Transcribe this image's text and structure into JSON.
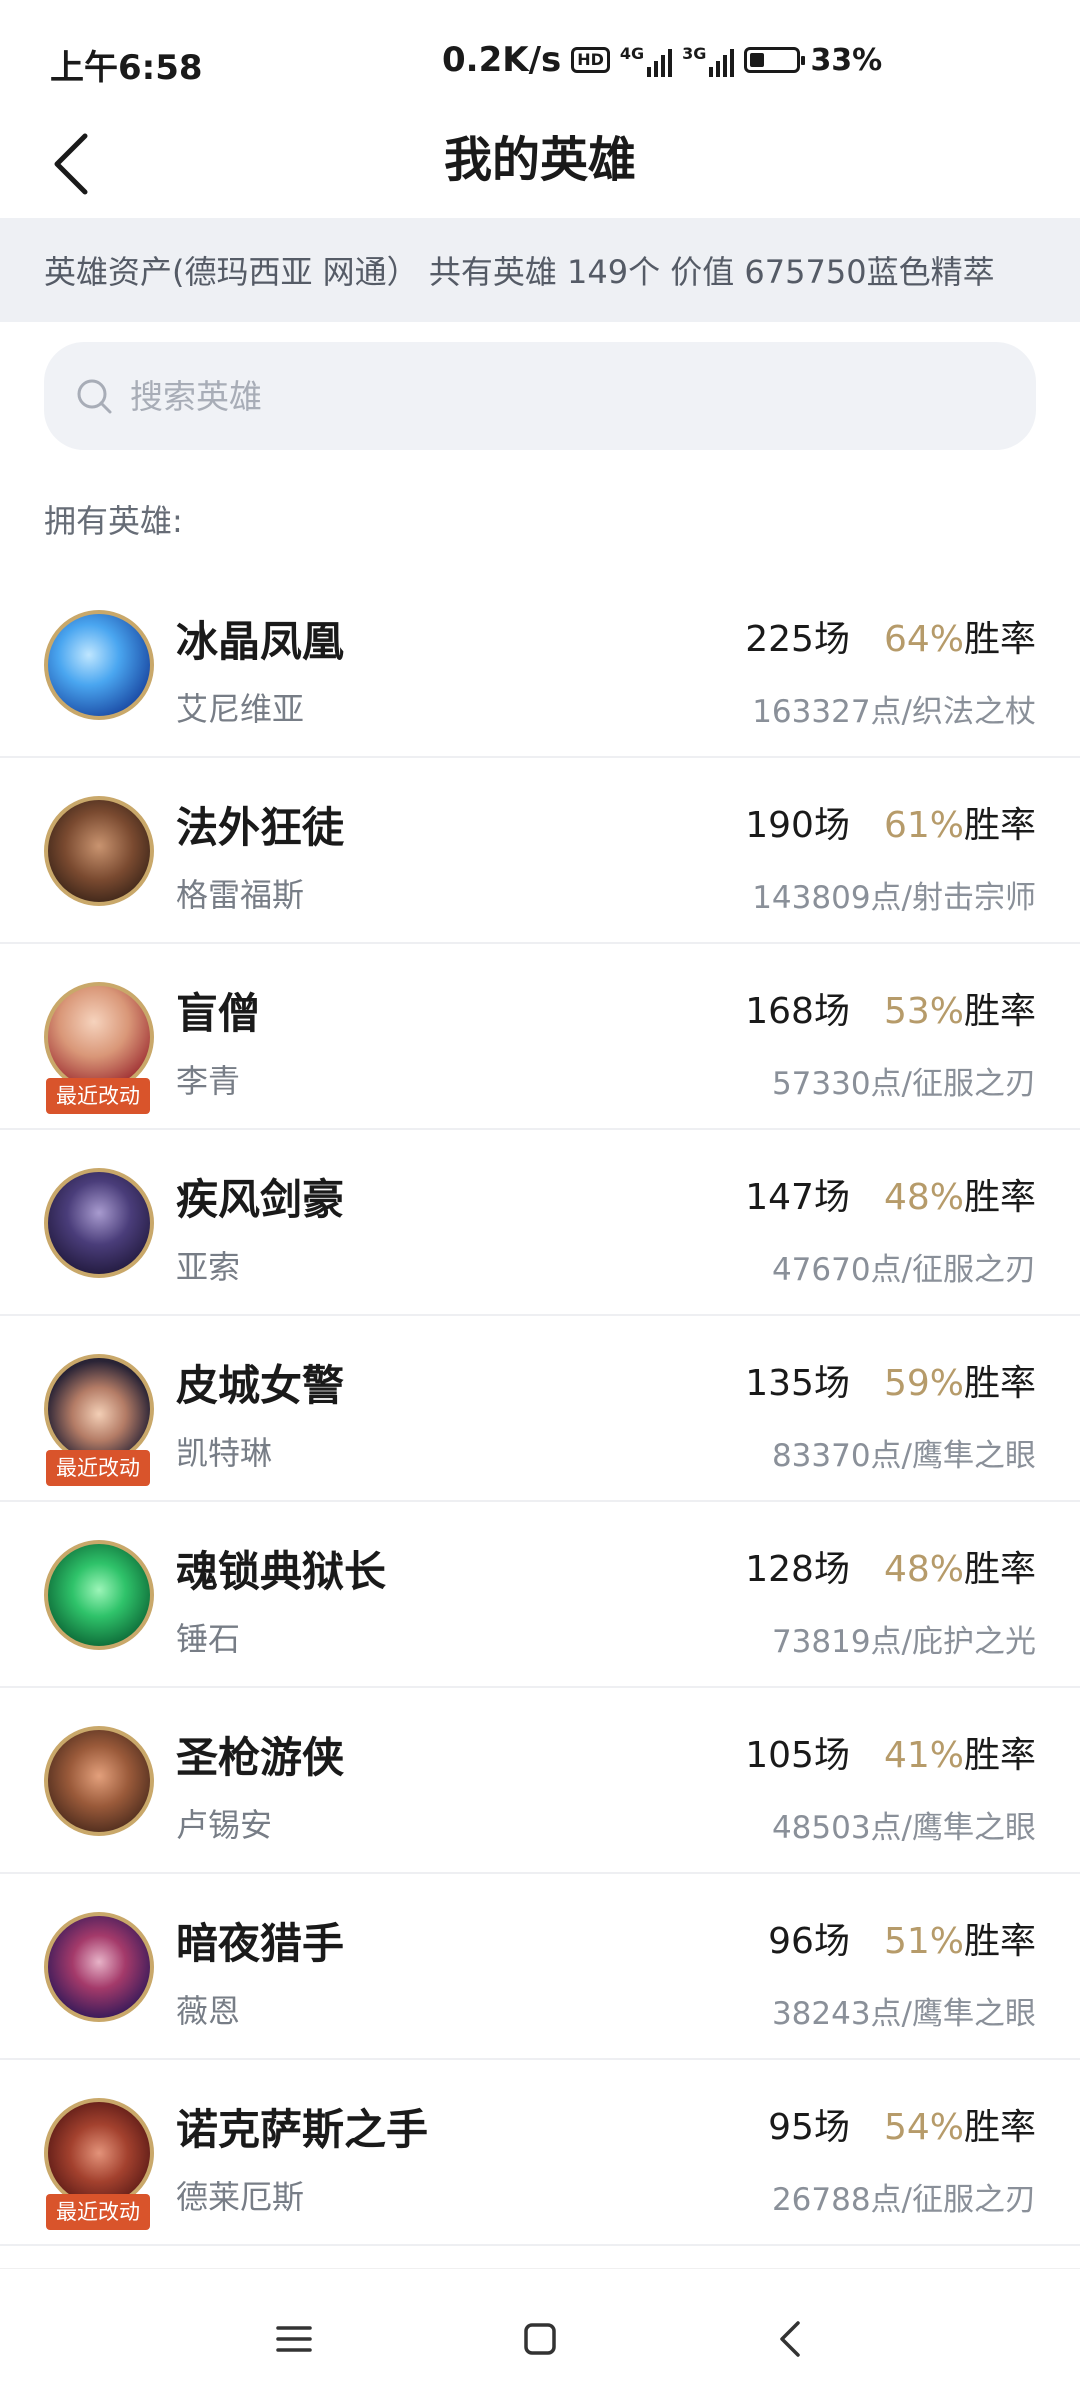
{
  "status_bar": {
    "time": "上午6:58",
    "speed": "0.2K/s",
    "hd": "HD",
    "net1": "4G",
    "net2": "3G",
    "battery": "33%"
  },
  "header": {
    "title": "我的英雄",
    "back_icon": "chevron-left-icon"
  },
  "banner": {
    "text": "英雄资产(德玛西亚 网通） 共有英雄 149个  价值 675750蓝色精萃"
  },
  "search": {
    "placeholder": "搜索英雄",
    "value": ""
  },
  "owned_label": "拥有英雄:",
  "colors": {
    "win_pct": "#b69b6a",
    "badge": "#d9542b",
    "avatar_border": "#c9a86a"
  },
  "heroes": [
    {
      "title": "冰晶凤凰",
      "name": "艾尼维亚",
      "games": "225场",
      "win_pct": "64%",
      "win_label": "胜率",
      "points": "163327点/织法之杖",
      "badge": ""
    },
    {
      "title": "法外狂徒",
      "name": "格雷福斯",
      "games": "190场",
      "win_pct": "61%",
      "win_label": "胜率",
      "points": "143809点/射击宗师",
      "badge": ""
    },
    {
      "title": "盲僧",
      "name": "李青",
      "games": "168场",
      "win_pct": "53%",
      "win_label": "胜率",
      "points": "57330点/征服之刃",
      "badge": "最近改动"
    },
    {
      "title": "疾风剑豪",
      "name": "亚索",
      "games": "147场",
      "win_pct": "48%",
      "win_label": "胜率",
      "points": "47670点/征服之刃",
      "badge": ""
    },
    {
      "title": "皮城女警",
      "name": "凯特琳",
      "games": "135场",
      "win_pct": "59%",
      "win_label": "胜率",
      "points": "83370点/鹰隼之眼",
      "badge": "最近改动"
    },
    {
      "title": "魂锁典狱长",
      "name": "锤石",
      "games": "128场",
      "win_pct": "48%",
      "win_label": "胜率",
      "points": "73819点/庇护之光",
      "badge": ""
    },
    {
      "title": "圣枪游侠",
      "name": "卢锡安",
      "games": "105场",
      "win_pct": "41%",
      "win_label": "胜率",
      "points": "48503点/鹰隼之眼",
      "badge": ""
    },
    {
      "title": "暗夜猎手",
      "name": "薇恩",
      "games": "96场",
      "win_pct": "51%",
      "win_label": "胜率",
      "points": "38243点/鹰隼之眼",
      "badge": ""
    },
    {
      "title": "诺克萨斯之手",
      "name": "德莱厄斯",
      "games": "95场",
      "win_pct": "54%",
      "win_label": "胜率",
      "points": "26788点/征服之刃",
      "badge": "最近改动"
    }
  ],
  "nav": {
    "menu_icon": "menu-icon",
    "home_icon": "home-square-icon",
    "back_icon": "back-triangle-icon"
  }
}
